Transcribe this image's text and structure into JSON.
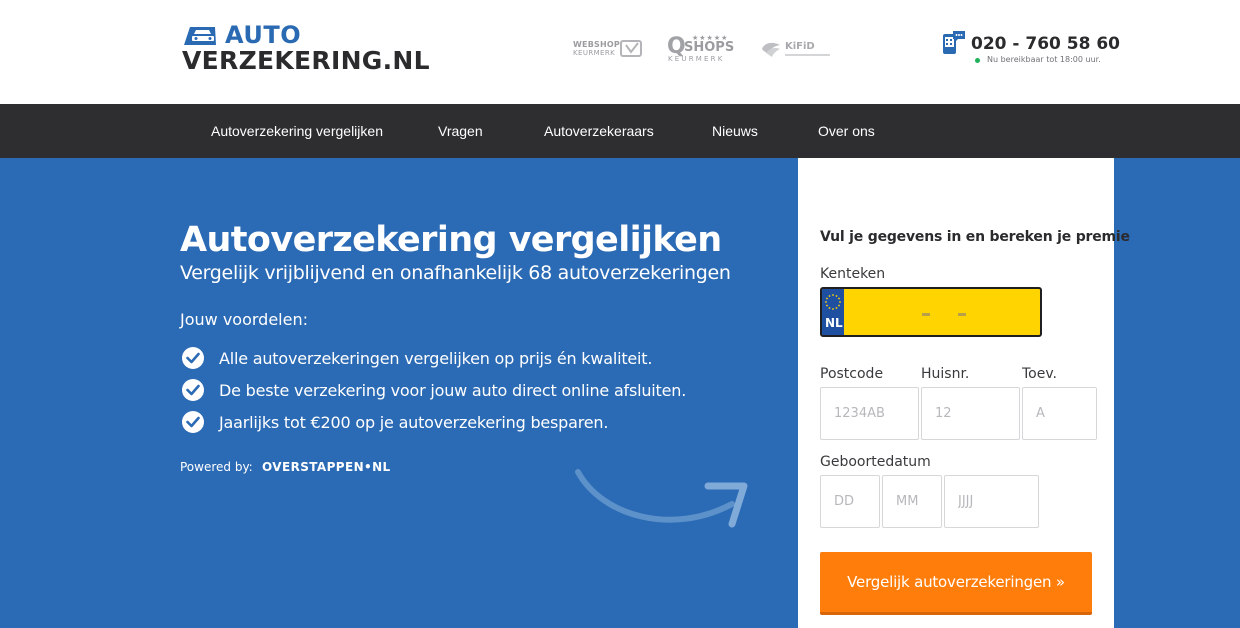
{
  "header": {
    "logo_top": "AUTO",
    "logo_bottom": "VERZEKERING.NL",
    "badges": {
      "webshop_line1": "WEBSHOP",
      "webshop_line2": "KEURMERK",
      "qshops_q": "Q",
      "qshops_stars": "★★★★★",
      "qshops_shops": "SHOPS",
      "qshops_keurmerk": "KEURMERK",
      "kifid": "KiFiD"
    },
    "phone": "020 - 760 58 60",
    "phone_status": "Nu bereikbaar tot 18:00 uur."
  },
  "nav": {
    "items": [
      "Autoverzekering vergelijken",
      "Vragen",
      "Autoverzekeraars",
      "Nieuws",
      "Over ons"
    ]
  },
  "hero": {
    "title": "Autoverzekering vergelijken",
    "subtitle": "Vergelijk vrijblijvend en onafhankelijk 68 autoverzekeringen",
    "benefits_heading": "Jouw voordelen:",
    "benefits": [
      "Alle autoverzekeringen vergelijken op prijs én kwaliteit.",
      "De beste verzekering voor jouw auto direct online afsluiten.",
      "Jaarlijks tot €200 op je autoverzekering besparen."
    ],
    "powered_label": "Powered by:",
    "powered_logo": "OVERSTAPPEN•NL"
  },
  "form": {
    "title": "Vul je gegevens in en bereken je premie",
    "kenteken_label": "Kenteken",
    "plate_country": "NL",
    "postcode_label": "Postcode",
    "huisnr_label": "Huisnr.",
    "toev_label": "Toev.",
    "postcode_placeholder": "1234AB",
    "huisnr_placeholder": "12",
    "toev_placeholder": "A",
    "geboortedatum_label": "Geboortedatum",
    "dd_placeholder": "DD",
    "mm_placeholder": "MM",
    "jjjj_placeholder": "JJJJ",
    "submit_label": "Vergelijk autoverzekeringen »"
  },
  "colors": {
    "brand_blue": "#2b6ab4",
    "nav_dark": "#2e2e31",
    "cta_orange": "#ff7d0b",
    "plate_yellow": "#ffd400"
  }
}
